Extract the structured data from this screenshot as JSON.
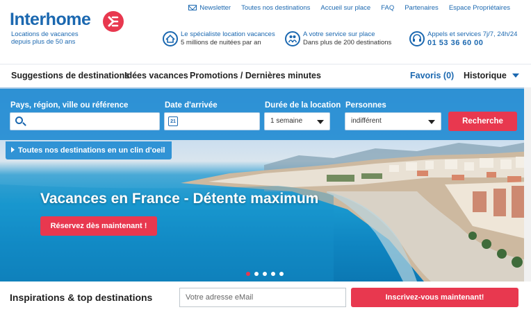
{
  "brand": {
    "name": "Interhome",
    "tagline_line1": "Locations de vacances",
    "tagline_line2": "depuis plus de 50 ans",
    "color": "#1b68b0",
    "accent": "#e8384f"
  },
  "toplinks": [
    "Newsletter",
    "Toutes nos destinations",
    "Accueil sur place",
    "FAQ",
    "Partenaires",
    "Espace Propriétaires"
  ],
  "usps": {
    "specialist": {
      "line1": "Le spécialiste location vacances",
      "line2": "5 millions de nuitées par an",
      "icon": "house-icon"
    },
    "service": {
      "line1": "A votre service sur place",
      "line2": "Dans plus de 200 destinations",
      "icon": "people-icon"
    },
    "phone": {
      "line1": "Appels et services 7j/7, 24h/24",
      "number": "01 53 36 60 00",
      "icon": "headset-icon"
    }
  },
  "nav": {
    "items": [
      "Suggestions de destinations",
      "Idées vacances",
      "Promotions / Dernières minutes"
    ],
    "favoris": "Favoris (0)",
    "historique": "Historique"
  },
  "search": {
    "destination_label": "Pays, région, ville ou référence",
    "destination_value": "",
    "arrival_label": "Date d'arrivée",
    "arrival_value": "",
    "calendar_day": "21",
    "duration_label": "Durée de la location",
    "duration_value": "1 semaine",
    "persons_label": "Personnes",
    "persons_value": "indifférent",
    "submit": "Recherche"
  },
  "all_destinations": "Toutes nos destinations en un clin d'oeil",
  "hero": {
    "title": "Vacances en France - Détente maximum",
    "cta": "Réservez dès maintenant !",
    "slides": 5,
    "active_slide": 1
  },
  "bottom": {
    "inspirations": "Inspirations & top destinations",
    "email_placeholder": "Votre adresse eMail",
    "subscribe": "Inscrivez-vous maintenant!"
  }
}
